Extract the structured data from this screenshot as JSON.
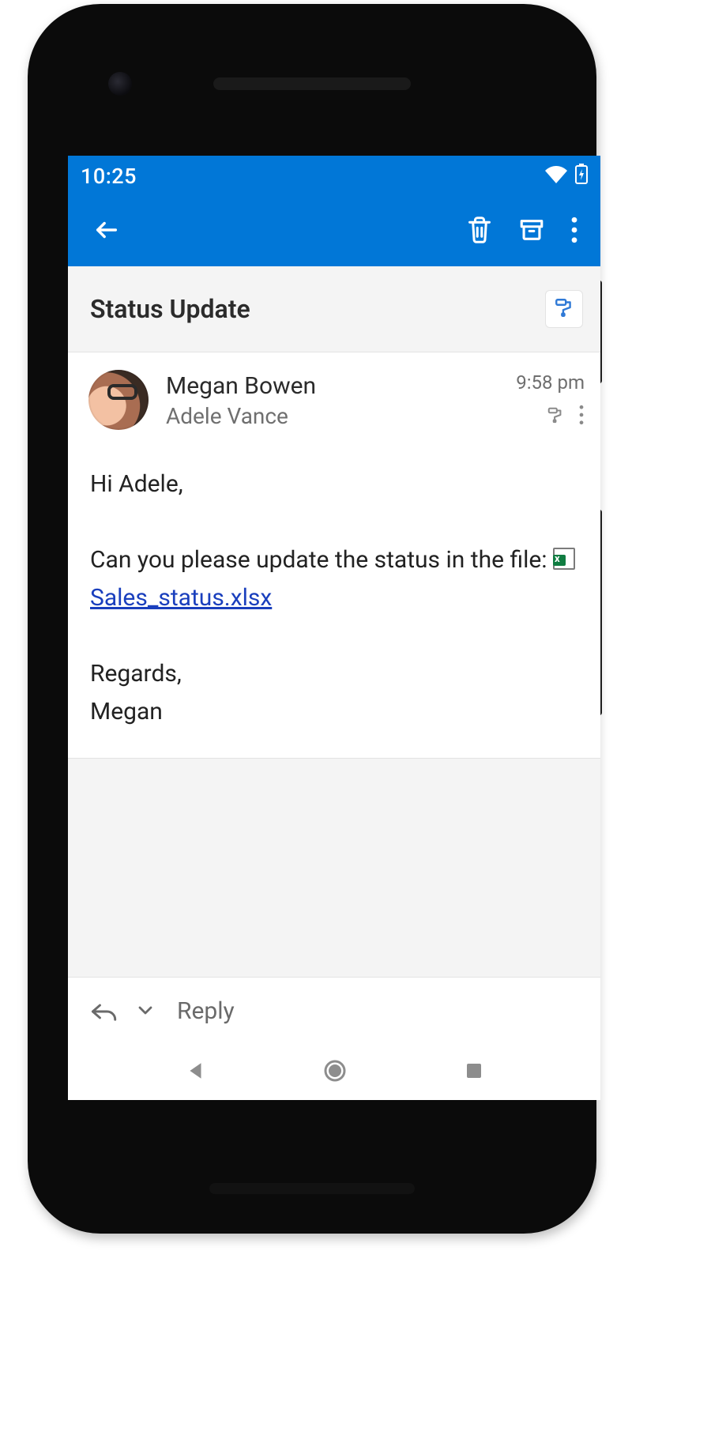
{
  "statusbar": {
    "time": "10:25"
  },
  "email": {
    "subject": "Status Update",
    "sender": "Megan Bowen",
    "recipient": "Adele Vance",
    "time": "9:58 pm",
    "body": {
      "greeting": "Hi Adele,",
      "line1_pre": "Can you please update the status in the file: ",
      "attachment_name": "Sales_status.xlsx",
      "signoff": "Regards,",
      "signature": "Megan"
    }
  },
  "reply": {
    "label": "Reply"
  },
  "colors": {
    "accent": "#0177d7",
    "link": "#1a3fbd",
    "excel": "#107c41"
  }
}
